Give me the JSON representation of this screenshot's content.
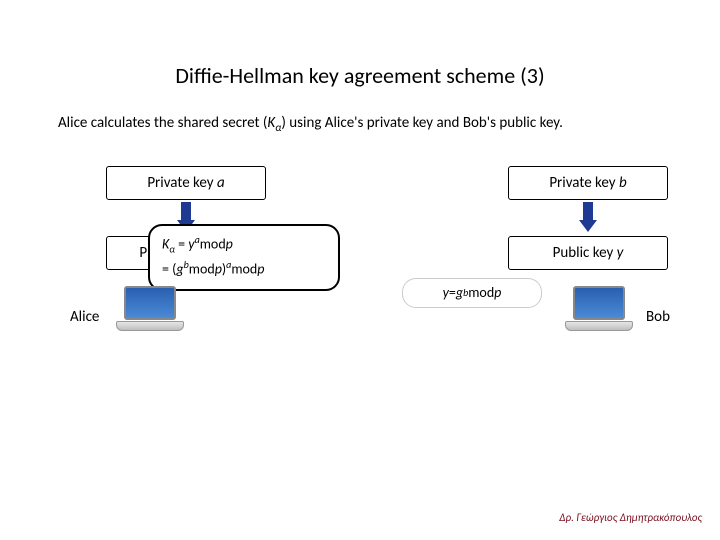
{
  "title": "Diffie-Hellman key agreement scheme (3)",
  "desc_pre": "Alice calculates the shared secret (",
  "desc_K": "K",
  "desc_alpha": "α",
  "desc_post": ") using Alice's private key and Bob's public key.",
  "priv_a_label": "Private key ",
  "priv_a_var": "a",
  "priv_b_label": "Private key ",
  "priv_b_var": "b",
  "pub_x_label": "Pu",
  "pub_y_label": "Public key ",
  "pub_y_var": "y",
  "calc_K": "K",
  "calc_alpha": "α",
  "calc_eq": " = ",
  "calc_y": "y",
  "calc_a": "a",
  "calc_mod": "mod",
  "calc_p": "p",
  "calc_row2_pre": "= (",
  "calc_g": "g",
  "calc_b": "b",
  "calc_row2_mid": ")",
  "yform_y": "y",
  "yform_eq": " = ",
  "yform_g": "g",
  "yform_b": "b",
  "yform_mod": "mod",
  "yform_p": "p",
  "alice": "Alice",
  "bob": "Bob",
  "footer": "Δρ. Γεώργιος Δημητρακόπουλος"
}
